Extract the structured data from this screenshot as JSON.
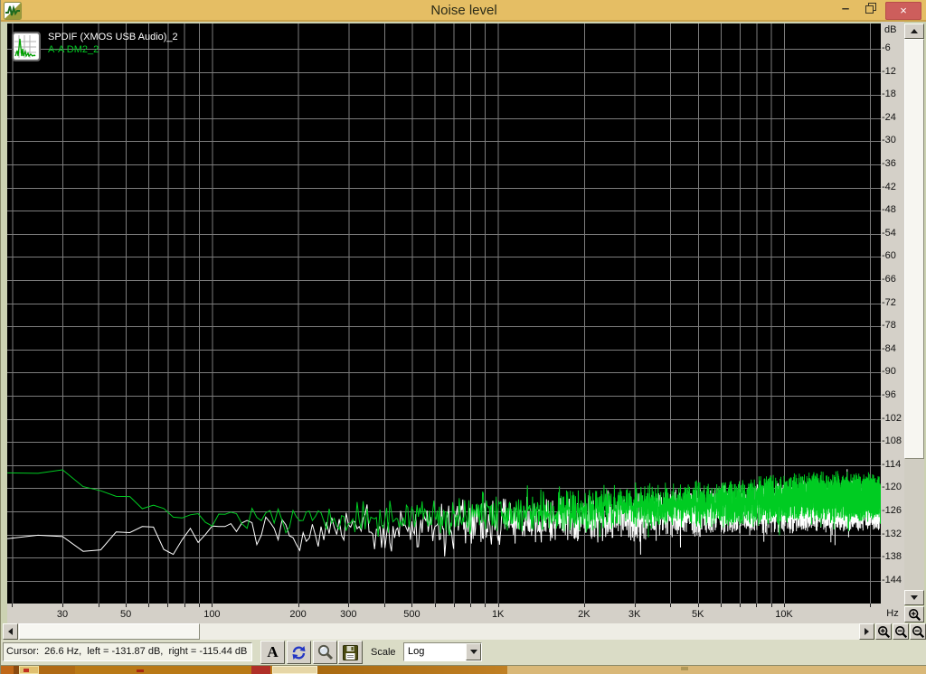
{
  "window": {
    "title": "Noise level"
  },
  "titlebar": {
    "minimize_glyph": "–",
    "close_glyph": "×"
  },
  "legend": {
    "series1": "SPDIF (XMOS USB Audio)_2",
    "series2": "A-A DM2_2",
    "series1_color": "#ffffff",
    "series2_color": "#00cc22"
  },
  "axes": {
    "y_unit": "dB",
    "x_unit": "Hz"
  },
  "toolbar": {
    "cursor_text": "Cursor:  26.6 Hz,  left = -131.87 dB,  right = -115.44 dB",
    "font_button_label": "A",
    "scale_label": "Scale",
    "scale_value": "Log"
  },
  "chart_data": {
    "type": "line",
    "title": "Noise level",
    "x_axis": {
      "scale": "log",
      "unit": "Hz",
      "min": 19.25,
      "max": 21800,
      "grid_min": 20,
      "grid_max": 20000,
      "labeled_ticks": [
        [
          "30",
          30
        ],
        [
          "50",
          50
        ],
        [
          "100",
          100
        ],
        [
          "200",
          200
        ],
        [
          "300",
          300
        ],
        [
          "500",
          500
        ],
        [
          "1K",
          1000
        ],
        [
          "2K",
          2000
        ],
        [
          "3K",
          3000
        ],
        [
          "5K",
          5000
        ],
        [
          "10K",
          10000
        ]
      ]
    },
    "y_axis": {
      "unit": "dB",
      "min": -150,
      "max": 0,
      "grid_step": 6,
      "label_min": -144,
      "label_max": -6
    },
    "resolution_hz": 5.4,
    "grid_color": "#7d7d7d",
    "cursor": {
      "freq_hz": 26.6,
      "left_db": -131.87,
      "right_db": -115.44
    },
    "series": [
      {
        "name": "SPDIF (XMOS USB Audio)_2",
        "color": "#ffffff",
        "noise_floor_envelope": [
          [
            19,
            -132.5,
            0.4
          ],
          [
            24,
            -132.2,
            0.5
          ],
          [
            27,
            -131.9,
            0.7
          ],
          [
            31,
            -133.5,
            1.5
          ],
          [
            36,
            -137.5,
            1.6
          ],
          [
            42,
            -135,
            2
          ],
          [
            48,
            -130.5,
            2.2
          ],
          [
            55,
            -128.5,
            2.5
          ],
          [
            62,
            -133,
            3
          ],
          [
            70,
            -136,
            3
          ],
          [
            80,
            -132,
            2.5
          ],
          [
            95,
            -131.5,
            1.8
          ],
          [
            110,
            -131.8,
            2
          ],
          [
            130,
            -129.8,
            2.5
          ],
          [
            160,
            -131,
            3
          ],
          [
            200,
            -131.5,
            3.5
          ],
          [
            260,
            -131,
            3.8
          ],
          [
            350,
            -130.5,
            4
          ],
          [
            500,
            -130,
            4.2
          ],
          [
            700,
            -129.5,
            4.3
          ],
          [
            1000,
            -129,
            4.4
          ],
          [
            1500,
            -128.5,
            4.4
          ],
          [
            2200,
            -127.6,
            4.4
          ],
          [
            3200,
            -127,
            4.4
          ],
          [
            4500,
            -126.5,
            4.4
          ],
          [
            6500,
            -125.6,
            4.5
          ],
          [
            9000,
            -125,
            4.5
          ],
          [
            12000,
            -124.6,
            4.5
          ],
          [
            16000,
            -124.4,
            4.5
          ],
          [
            21800,
            -125,
            4
          ]
        ]
      },
      {
        "name": "A-A DM2_2",
        "color": "#00cc22",
        "noise_floor_envelope": [
          [
            19,
            -116,
            0.25
          ],
          [
            27,
            -115.6,
            0.3
          ],
          [
            30,
            -115.4,
            0.35
          ],
          [
            33,
            -118.8,
            0.6
          ],
          [
            38,
            -119.3,
            0.6
          ],
          [
            44,
            -122.5,
            0.8
          ],
          [
            50,
            -121.8,
            0.7
          ],
          [
            57,
            -124,
            0.9
          ],
          [
            65,
            -124.8,
            1
          ],
          [
            75,
            -126.3,
            1.3
          ],
          [
            90,
            -127,
            1.5
          ],
          [
            105,
            -128.8,
            1.6
          ],
          [
            125,
            -127.6,
            2
          ],
          [
            150,
            -127.8,
            2.3
          ],
          [
            200,
            -128,
            2.8
          ],
          [
            280,
            -128,
            3.2
          ],
          [
            400,
            -128,
            3.5
          ],
          [
            600,
            -127.3,
            3.8
          ],
          [
            900,
            -126.8,
            4
          ],
          [
            1300,
            -126.2,
            4
          ],
          [
            2000,
            -125.4,
            4.2
          ],
          [
            3000,
            -124.7,
            4.2
          ],
          [
            4500,
            -124.3,
            4.2
          ],
          [
            6500,
            -123.8,
            4.3
          ],
          [
            9000,
            -123.1,
            4.3
          ],
          [
            12000,
            -122.4,
            4.3
          ],
          [
            16000,
            -121.9,
            4.3
          ],
          [
            21800,
            -122.8,
            4
          ]
        ]
      }
    ]
  }
}
